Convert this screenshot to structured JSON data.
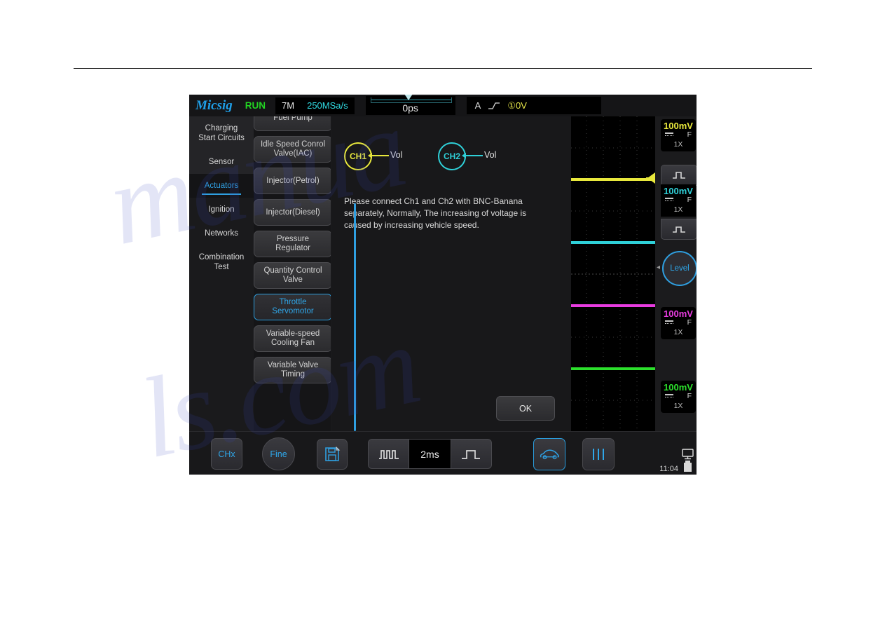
{
  "device": {
    "brand": "Micsig",
    "run_state": "RUN",
    "memory_depth": "7M",
    "sample_rate": "250MSa/s",
    "horizontal_position": "0ps",
    "trigger": {
      "source_letter": "A",
      "edge_icon": "rising-edge-icon",
      "channel_marker": "①",
      "level": "0V"
    }
  },
  "sidebar": {
    "items": [
      {
        "label": "Charging\nStart Circuits",
        "active": false
      },
      {
        "label": "Sensor",
        "active": false
      },
      {
        "label": "Actuators",
        "active": true
      },
      {
        "label": "Ignition",
        "active": false
      },
      {
        "label": "Networks",
        "active": false
      },
      {
        "label": "Combination\nTest",
        "active": false
      }
    ]
  },
  "component_list": {
    "items": [
      {
        "label": "Fuel Pump",
        "selected": false
      },
      {
        "label": "Idle Speed Conrol\nValve(IAC)",
        "selected": false
      },
      {
        "label": "Injector(Petrol)",
        "selected": false
      },
      {
        "label": "Injector(Diesel)",
        "selected": false
      },
      {
        "label": "Pressure\nRegulator",
        "selected": false
      },
      {
        "label": "Quantity Control\nValve",
        "selected": false
      },
      {
        "label": "Throttle\nServomotor",
        "selected": true
      },
      {
        "label": "Variable-speed\nCooling Fan",
        "selected": false
      },
      {
        "label": "Variable Valve\nTiming",
        "selected": false
      }
    ]
  },
  "content": {
    "nodes": [
      {
        "name": "CH1",
        "signal": "Vol",
        "color": "#e8e83c"
      },
      {
        "name": "CH2",
        "signal": "Vol",
        "color": "#2fd0d8"
      }
    ],
    "description": "Please connect Ch1 and Ch2 with BNC-Banana separately, Normally, The increasing of voltage is caused by increasing vehicle speed.",
    "ok_label": "OK"
  },
  "channels": [
    {
      "id": "CH1",
      "volts_div": "100mV",
      "coupling": "DC",
      "filter": "F",
      "probe": "1X",
      "color": "#e8e83c"
    },
    {
      "id": "CH2",
      "volts_div": "100mV",
      "coupling": "DC",
      "filter": "F",
      "probe": "1X",
      "color": "#2fd0d8"
    },
    {
      "id": "CH3",
      "volts_div": "100mV",
      "coupling": "DC",
      "filter": "F",
      "probe": "1X",
      "color": "#e83ce0"
    },
    {
      "id": "CH4",
      "volts_div": "100mV",
      "coupling": "DC",
      "filter": "F",
      "probe": "1X",
      "color": "#2ce02c"
    }
  ],
  "trigger_control": {
    "level_label": "Level"
  },
  "toolbar": {
    "chx_label": "CHx",
    "fine_label": "Fine",
    "save_icon": "save-file-icon",
    "timebase_value": "2ms",
    "timebase_decrease_icon": "fast-pulse-icon",
    "timebase_increase_icon": "slow-pulse-icon",
    "vehicle_icon": "car-icon",
    "menu_icon": "vertical-bars-icon"
  },
  "status": {
    "clock": "11:04",
    "display_icon": "monitor-icon",
    "battery_icon": "battery-icon"
  },
  "watermark": {
    "line1": "manua",
    "line2": "ls.com"
  }
}
